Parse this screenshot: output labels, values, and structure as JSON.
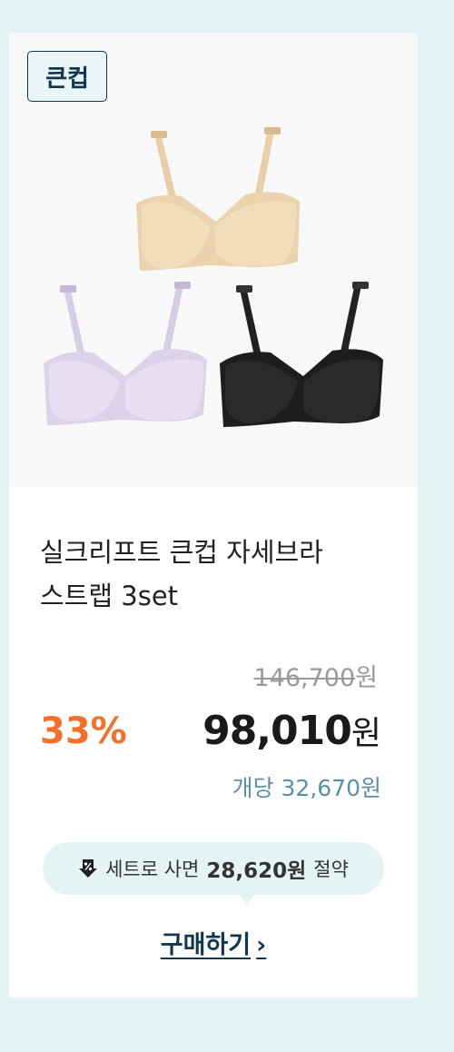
{
  "product": {
    "badge": "큰컵",
    "title_line1": "실크리프트 큰컵 자세브라",
    "title_line2": "스트랩 3set",
    "image_alt": "product-photo-three-bras",
    "colors": {
      "beige": "#ecd2ad",
      "lavender": "#dcd2ea",
      "black": "#1d1d1d"
    }
  },
  "pricing": {
    "original_price": "146,700",
    "original_unit": "원",
    "discount_rate": "33%",
    "sale_price": "98,010",
    "sale_unit": "원",
    "per_unit": "개당 32,670원"
  },
  "savings": {
    "prefix": "세트로 사면",
    "amount": "28,620원",
    "suffix": "절약",
    "icon": "percent-down-arrow-icon"
  },
  "cta": {
    "label": "구매하기",
    "chevron": "›"
  },
  "theme": {
    "accent_orange": "#f26f2c",
    "navy": "#10374f",
    "mint_bg": "#e4f3f4",
    "per_unit_blue": "#5b8fa6"
  }
}
